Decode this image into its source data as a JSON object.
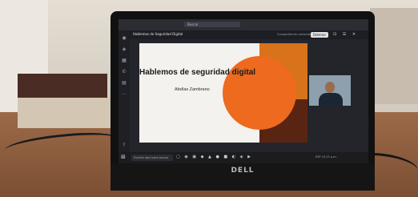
{
  "teams": {
    "search_placeholder": "Buscar",
    "meeting_title": "Hablemos de Seguridad Digital",
    "share_label": "Compartiendo contenido",
    "stop_label": "Detener"
  },
  "slide": {
    "title": "Hablemos de seguridad digital",
    "author": "Abdías Zambrano"
  },
  "taskbar": {
    "search_placeholder": "Escribe aquí para buscar",
    "tray_text": "ESP  10:15 a.m."
  },
  "laptop": {
    "brand": "DELL"
  },
  "icons": [
    "chat-icon",
    "teams-icon",
    "calendar-icon",
    "calls-icon",
    "files-icon",
    "apps-icon",
    "help-icon",
    "windows-start-icon"
  ]
}
